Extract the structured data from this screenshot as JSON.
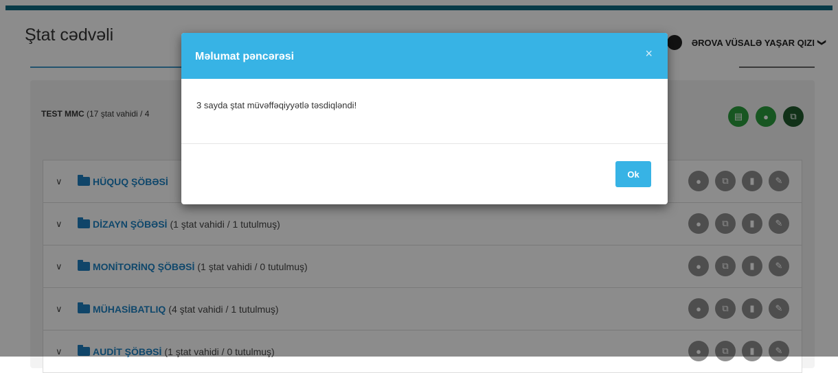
{
  "header": {
    "title": "Ştat cədvəli",
    "user_name": "ƏROVA VÜSALƏ YAŞAR QIZI",
    "user_chevron": "❯"
  },
  "company": {
    "name": "TEST MMC",
    "count_text": "(17 ştat vahidi / 4"
  },
  "top_icons": [
    {
      "name": "archive-icon",
      "glyph": "▤"
    },
    {
      "name": "user-icon",
      "glyph": "●"
    },
    {
      "name": "sitemap-icon",
      "glyph": "⧉"
    }
  ],
  "departments": [
    {
      "name": "HÜQUQ ŞÖBƏSİ",
      "count": ""
    },
    {
      "name": "DİZAYN ŞÖBƏSİ",
      "count": "(1 ştat vahidi / 1 tutulmuş)"
    },
    {
      "name": "MONİTORİNQ ŞÖBƏSİ",
      "count": "(1 ştat vahidi / 0 tutulmuş)"
    },
    {
      "name": "MÜHASİBATLIQ",
      "count": "(4 ştat vahidi / 1 tutulmuş)"
    },
    {
      "name": "AUDİT ŞÖBƏSİ",
      "count": "(1 ştat vahidi / 0 tutulmuş)"
    }
  ],
  "row_icons": {
    "chevron": "∨",
    "user": "●",
    "sitemap": "⧉",
    "trash": "▮",
    "edit": "✎"
  },
  "modal": {
    "title": "Məlumat pəncərəsi",
    "close": "×",
    "message": "3 sayda ştat müvəffəqiyyətlə təsdiqləndi!",
    "ok_label": "Ok"
  },
  "colors": {
    "accent": "#0f6b82",
    "modal_header": "#37b3e5",
    "link": "#1d82c4",
    "green": "#2a9d3c",
    "dark_green": "#1f5a2c"
  }
}
